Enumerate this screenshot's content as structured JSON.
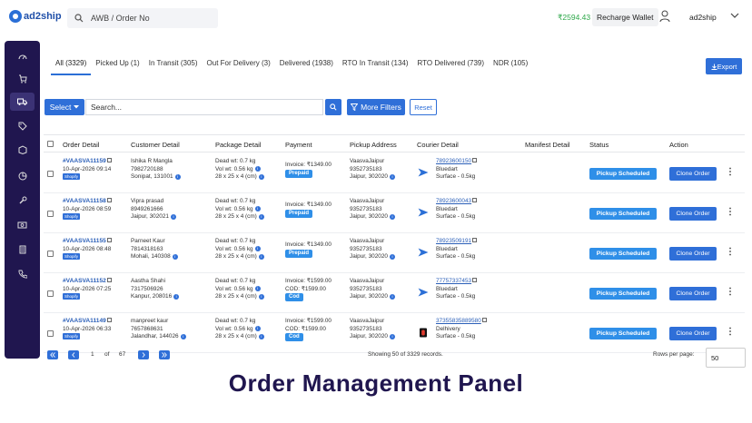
{
  "header": {
    "logo_text": "ad2ship",
    "search_placeholder": "AWB / Order No",
    "wallet_amount": "₹2594.43",
    "recharge_label": "Recharge Wallet",
    "user_name": "ad2ship"
  },
  "sidebar": {
    "items": [
      {
        "icon": "speedometer-icon"
      },
      {
        "icon": "cart-icon"
      },
      {
        "icon": "truck-icon",
        "active": true
      },
      {
        "icon": "tag-icon"
      },
      {
        "icon": "box-icon"
      },
      {
        "icon": "pie-chart-icon"
      },
      {
        "icon": "wrench-icon"
      },
      {
        "icon": "money-icon"
      },
      {
        "icon": "calculator-icon"
      },
      {
        "icon": "phone-icon"
      }
    ]
  },
  "tabs": [
    {
      "label": "All (3329)"
    },
    {
      "label": "Picked Up (1)"
    },
    {
      "label": "In Transit (305)"
    },
    {
      "label": "Out For Delivery (3)"
    },
    {
      "label": "Delivered (1938)"
    },
    {
      "label": "RTO In Transit (134)"
    },
    {
      "label": "RTO Delivered (739)"
    },
    {
      "label": "NDR (105)"
    }
  ],
  "export_label": "Export",
  "filters": {
    "select_label": "Select",
    "search_placeholder": "Search...",
    "more_filters_label": "More Filters",
    "reset_label": "Reset"
  },
  "columns": [
    "Order Detail",
    "Customer Detail",
    "Package Detail",
    "Payment",
    "Pickup Address",
    "Courier Detail",
    "Manifest Detail",
    "Status",
    "Action"
  ],
  "orders": [
    {
      "order_id": "#VAASVA11159",
      "date": "10-Apr-2026 09:14",
      "channel": "Shopify",
      "customer_name": "Ishika R Mangla",
      "phone": "7982720188",
      "location": "Sonipat, 131001",
      "dead_wt": "Dead wt: 0.7 kg",
      "vol_wt": "Vol wt: 0.56 kg",
      "dims": "28 x 25 x 4 (cm)",
      "invoice": "Invoice: ₹1349.00",
      "cod": "",
      "pay_type": "Prepaid",
      "pickup_name": "VaasvaJaipur",
      "pickup_phone": "9352735183",
      "pickup_loc": "Jaipur, 302020",
      "awb": "78923600150",
      "courier": "Bluedart",
      "service": "Surface - 0.5kg",
      "courier_logo": "bluedart-logo-icon",
      "status": "Pickup Scheduled",
      "clone_label": "Clone Order"
    },
    {
      "order_id": "#VAASVA11158",
      "date": "10-Apr-2026 08:59",
      "channel": "Shopify",
      "customer_name": "Vipra prasad",
      "phone": "8949261666",
      "location": "Jaipur, 302021",
      "dead_wt": "Dead wt: 0.7 kg",
      "vol_wt": "Vol wt: 0.56 kg",
      "dims": "28 x 25 x 4 (cm)",
      "invoice": "Invoice: ₹1349.00",
      "cod": "",
      "pay_type": "Prepaid",
      "pickup_name": "VaasvaJaipur",
      "pickup_phone": "9352735183",
      "pickup_loc": "Jaipur, 302020",
      "awb": "78923600043",
      "courier": "Bluedart",
      "service": "Surface - 0.5kg",
      "courier_logo": "bluedart-logo-icon",
      "status": "Pickup Scheduled",
      "clone_label": "Clone Order"
    },
    {
      "order_id": "#VAASVA11155",
      "date": "10-Apr-2026 08:48",
      "channel": "Shopify",
      "customer_name": "Parneet Kaur",
      "phone": "7814318163",
      "location": "Mohali, 140308",
      "dead_wt": "Dead wt: 0.7 kg",
      "vol_wt": "Vol wt: 0.56 kg",
      "dims": "28 x 25 x 4 (cm)",
      "invoice": "Invoice: ₹1349.00",
      "cod": "",
      "pay_type": "Prepaid",
      "pickup_name": "VaasvaJaipur",
      "pickup_phone": "9352735183",
      "pickup_loc": "Jaipur, 302020",
      "awb": "78923509191",
      "courier": "Bluedart",
      "service": "Surface - 0.5kg",
      "courier_logo": "bluedart-logo-icon",
      "status": "Pickup Scheduled",
      "clone_label": "Clone Order"
    },
    {
      "order_id": "#VAASVA11152",
      "date": "10-Apr-2026 07:25",
      "channel": "Shopify",
      "customer_name": "Aastha Shahi",
      "phone": "7317506926",
      "location": "Kanpur, 208016",
      "dead_wt": "Dead wt: 0.7 kg",
      "vol_wt": "Vol wt: 0.56 kg",
      "dims": "28 x 25 x 4 (cm)",
      "invoice": "Invoice: ₹1599.00",
      "cod": "COD: ₹1599.00",
      "pay_type": "Cod",
      "pickup_name": "VaasvaJaipur",
      "pickup_phone": "9352735183",
      "pickup_loc": "Jaipur, 302020",
      "awb": "77757337453",
      "courier": "Bluedart",
      "service": "Surface - 0.5kg",
      "courier_logo": "bluedart-logo-icon",
      "status": "Pickup Scheduled",
      "clone_label": "Clone Order"
    },
    {
      "order_id": "#VAASVA11149",
      "date": "10-Apr-2026 06:33",
      "channel": "Shopify",
      "customer_name": "manpreet kaur",
      "phone": "7657868631",
      "location": "Jalandhar, 144026",
      "dead_wt": "Dead wt: 0.7 kg",
      "vol_wt": "Vol wt: 0.56 kg",
      "dims": "28 x 25 x 4 (cm)",
      "invoice": "Invoice: ₹1599.00",
      "cod": "COD: ₹1599.00",
      "pay_type": "Cod",
      "pickup_name": "VaasvaJaipur",
      "pickup_phone": "9352735183",
      "pickup_loc": "Jaipur, 302020",
      "awb": "37355835889580",
      "courier": "Delhivery",
      "service": "Surface - 0.5kg",
      "courier_logo": "delhivery-logo-icon",
      "status": "Pickup Scheduled",
      "clone_label": "Clone Order"
    }
  ],
  "pagination": {
    "current_page": "1",
    "of_label": "of",
    "total_pages": "67",
    "showing_text": "Showing 50 of 3329 records.",
    "rows_per_page_label": "Rows per page:",
    "rows_per_page_value": "50"
  },
  "caption": "Order Management Panel"
}
